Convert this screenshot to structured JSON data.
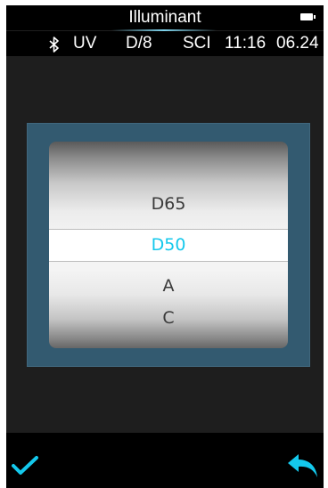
{
  "header": {
    "title": "Illuminant",
    "battery_icon": "battery-icon"
  },
  "status": {
    "bluetooth_icon": "bluetooth-icon",
    "uv": "UV",
    "geometry": "D/8",
    "mode": "SCI",
    "time": "11:16",
    "date": "06.24"
  },
  "picker": {
    "items": [
      {
        "label": "D65"
      },
      {
        "label": "D50"
      },
      {
        "label": "A"
      },
      {
        "label": "C"
      }
    ],
    "selected_label": "D50"
  },
  "footer": {
    "confirm_icon": "checkmark-icon",
    "back_icon": "back-arrow-icon"
  },
  "colors": {
    "accent": "#14c8ec",
    "picker_frame": "#335a70",
    "screen_background": "#1e1e1e",
    "bar_background": "#000000"
  }
}
